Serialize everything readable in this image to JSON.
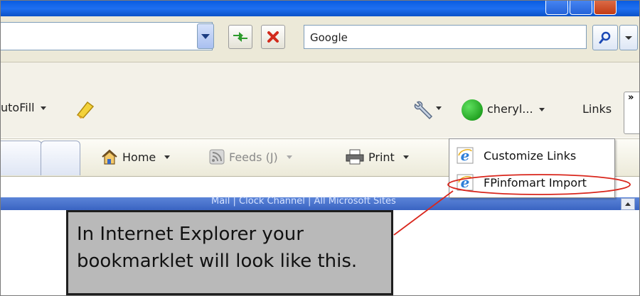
{
  "search": {
    "value": "Google"
  },
  "toolbar_row": {
    "autofill_label": "utoFill",
    "username_label": "cheryl...",
    "links_label": "Links",
    "chevron_label": "»"
  },
  "command_bar": {
    "home_label": "Home",
    "feeds_label": "Feeds (J)",
    "print_label": "Print"
  },
  "links_menu": {
    "items": [
      {
        "label": "Customize Links",
        "icon": "ie-icon"
      },
      {
        "label": "FPinfomart Import",
        "icon": "ie-icon"
      }
    ]
  },
  "strip": {
    "text": "Mail   |   Clock   Channel   |   All Microsoft Sites"
  },
  "callout": {
    "text": "In Internet Explorer your\nbookmarklet will look like this."
  },
  "colors": {
    "annotation_red": "#d9261c",
    "callout_fill": "#b9b9b9",
    "titlebar_blue": "#1f6ff0"
  }
}
